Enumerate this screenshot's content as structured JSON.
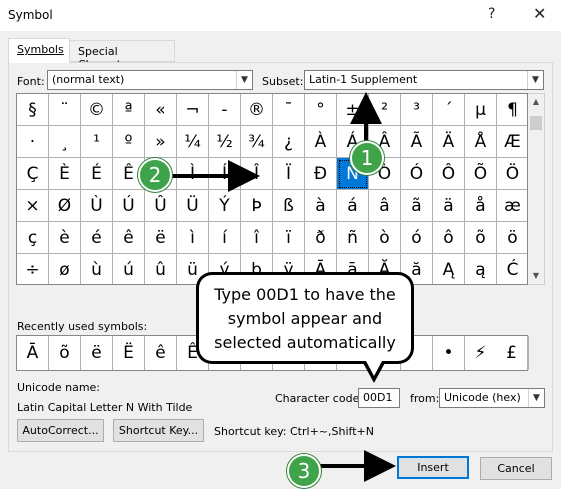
{
  "window": {
    "title": "Symbol",
    "help": "?",
    "close": "✕"
  },
  "tabs": [
    {
      "label": "Symbols",
      "active": true
    },
    {
      "label": "Special Characters",
      "active": false
    }
  ],
  "font": {
    "label": "Font:",
    "value": "(normal text)"
  },
  "subset": {
    "label": "Subset:",
    "value": "Latin-1 Supplement"
  },
  "grid": {
    "rows": [
      [
        "§",
        "¨",
        "©",
        "ª",
        "«",
        "¬",
        "-",
        "®",
        "¯",
        "°",
        "±",
        "²",
        "³",
        "´",
        "µ",
        "¶"
      ],
      [
        "·",
        "¸",
        "¹",
        "º",
        "»",
        "¼",
        "½",
        "¾",
        "¿",
        "À",
        "Á",
        "Â",
        "Ã",
        "Ä",
        "Å",
        "Æ"
      ],
      [
        "Ç",
        "È",
        "É",
        "Ê",
        "Ë",
        "Ì",
        "Í",
        "Î",
        "Ï",
        "Ð",
        "Ñ",
        "Ò",
        "Ó",
        "Ô",
        "Õ",
        "Ö"
      ],
      [
        "×",
        "Ø",
        "Ù",
        "Ú",
        "Û",
        "Ü",
        "Ý",
        "Þ",
        "ß",
        "à",
        "á",
        "â",
        "ã",
        "ä",
        "å",
        "æ"
      ],
      [
        "ç",
        "è",
        "é",
        "ê",
        "ë",
        "ì",
        "í",
        "î",
        "ï",
        "ð",
        "ñ",
        "ò",
        "ó",
        "ô",
        "õ",
        "ö"
      ],
      [
        "÷",
        "ø",
        "ù",
        "ú",
        "û",
        "ü",
        "ý",
        "þ",
        "ÿ",
        "Ā",
        "ā",
        "Ă",
        "ă",
        "Ą",
        "ą",
        "Ć"
      ]
    ],
    "selected": "Ñ"
  },
  "recent": {
    "label": "Recently used symbols:",
    "symbols": [
      "Ā",
      "õ",
      "ë",
      "Ë",
      "ê",
      "Ê",
      "",
      "",
      "",
      "",
      "",
      "",
      "",
      "•",
      "⚡",
      "⚠"
    ],
    "last": "£"
  },
  "unicode": {
    "label": "Unicode name:",
    "value": "Latin Capital Letter N With Tilde"
  },
  "charcode": {
    "label": "Character code:",
    "value": "00D1"
  },
  "from": {
    "label": "from:",
    "value": "Unicode (hex)"
  },
  "buttons": {
    "autocorrect": "AutoCorrect...",
    "shortcut_key": "Shortcut Key...",
    "insert": "Insert",
    "cancel": "Cancel"
  },
  "shortcut_text": "Shortcut key: Ctrl+~,Shift+N",
  "callout": {
    "line1": "Type 00D1 to have the",
    "line2": "symbol appear and",
    "line3": "selected automatically"
  },
  "steps": [
    "1",
    "2",
    "3"
  ],
  "colors": {
    "selection": "#0078d7",
    "badge": "#3fa34a"
  }
}
